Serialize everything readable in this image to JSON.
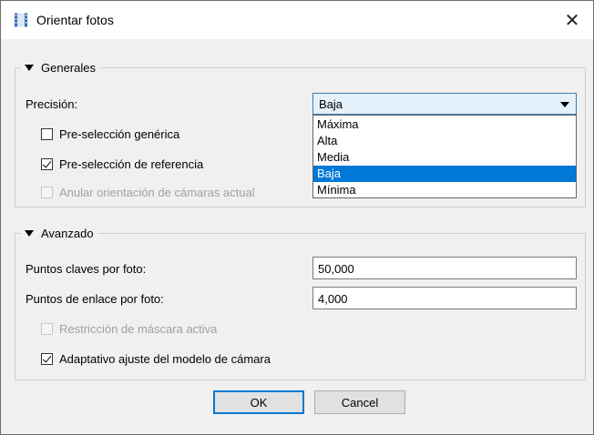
{
  "window": {
    "title": "Orientar fotos",
    "close_label": "✕"
  },
  "generales": {
    "legend": "Generales",
    "precision_label": "Precisión:",
    "precision_value": "Baja",
    "precision_options": [
      "Máxima",
      "Alta",
      "Media",
      "Baja",
      "Mínima"
    ],
    "preselect_generic": {
      "label": "Pre-selección genérica",
      "checked": false,
      "enabled": true
    },
    "preselect_reference": {
      "label": "Pre-selección de referencia",
      "checked": true,
      "enabled": true
    },
    "reset_orientation": {
      "label": "Anular orientación de cámaras actual",
      "checked": false,
      "enabled": false
    }
  },
  "avanzado": {
    "legend": "Avanzado",
    "keypoints_label": "Puntos claves por foto:",
    "keypoints_value": "50,000",
    "tiepoints_label": "Puntos de enlace por foto:",
    "tiepoints_value": "4,000",
    "mask_constraint": {
      "label": "Restricción de máscara activa",
      "checked": false,
      "enabled": false
    },
    "adaptive_fit": {
      "label": "Adaptativo ajuste del modelo de cámara",
      "checked": true,
      "enabled": true
    }
  },
  "buttons": {
    "ok": "OK",
    "cancel": "Cancel"
  },
  "colors": {
    "selection": "#0078d7",
    "window_bg": "#f0f0f0"
  },
  "icons": {
    "title_icon": "film-icon"
  }
}
